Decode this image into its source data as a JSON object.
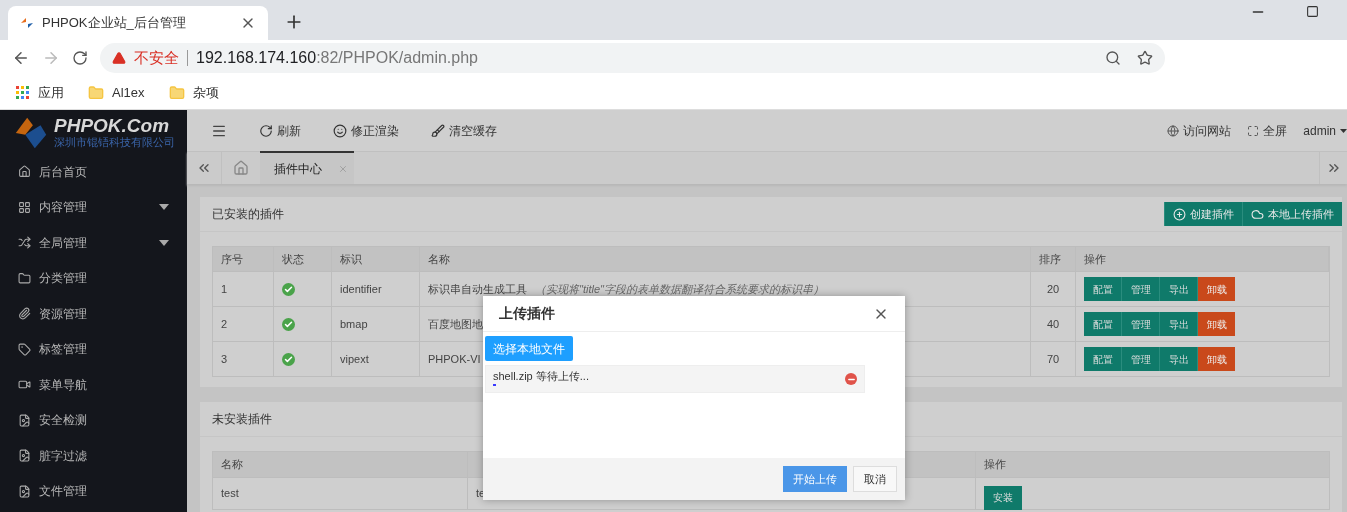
{
  "browser": {
    "tab_title": "PHPOK企业站_后台管理",
    "security_label": "不安全",
    "url_host": "192.168.174.160",
    "url_rest": ":82/PHPOK/admin.php",
    "bookmarks": [
      {
        "label": "应用",
        "kind": "apps"
      },
      {
        "label": "Al1ex",
        "kind": "folder"
      },
      {
        "label": "杂项",
        "kind": "folder"
      }
    ]
  },
  "logo": {
    "title": "PHPOK.Com",
    "subtitle": "深圳市锟铻科技有限公司"
  },
  "sidebar": {
    "items": [
      {
        "label": "后台首页",
        "expandable": false
      },
      {
        "label": "内容管理",
        "expandable": true
      },
      {
        "label": "全局管理",
        "expandable": true
      },
      {
        "label": "分类管理",
        "expandable": false
      },
      {
        "label": "资源管理",
        "expandable": false
      },
      {
        "label": "标签管理",
        "expandable": false
      },
      {
        "label": "菜单导航",
        "expandable": false
      },
      {
        "label": "安全检测",
        "expandable": false
      },
      {
        "label": "脏字过滤",
        "expandable": false
      },
      {
        "label": "文件管理",
        "expandable": false
      }
    ]
  },
  "toolbar": {
    "items": [
      {
        "label": "刷新"
      },
      {
        "label": "修正渲染"
      },
      {
        "label": "清空缓存"
      }
    ],
    "right": [
      {
        "label": "访问网站"
      },
      {
        "label": "全屏"
      }
    ],
    "user": "admin"
  },
  "tabs": [
    {
      "label": "插件中心",
      "selected": true
    }
  ],
  "installed": {
    "title": "已安装的插件",
    "actions": [
      {
        "label": "创建插件"
      },
      {
        "label": "本地上传插件"
      }
    ],
    "columns": [
      "序号",
      "状态",
      "标识",
      "名称",
      "排序",
      "操作"
    ],
    "rows": [
      {
        "index": "1",
        "enabled": true,
        "identifier": "identifier",
        "name": "标识串自动生成工具",
        "note": "（实现将\"title\"字段的表单数据翻译符合系统要求的标识串）",
        "sort": "20",
        "buttons": [
          {
            "label": "配置",
            "kind": "primary"
          },
          {
            "label": "管理",
            "kind": "primary"
          },
          {
            "label": "导出",
            "kind": "primary"
          },
          {
            "label": "卸载",
            "kind": "danger"
          }
        ]
      },
      {
        "index": "2",
        "enabled": true,
        "identifier": "bmap",
        "name": "百度地图地",
        "sort": "40",
        "buttons": [
          {
            "label": "配置",
            "kind": "primary"
          },
          {
            "label": "管理",
            "kind": "primary"
          },
          {
            "label": "导出",
            "kind": "primary"
          },
          {
            "label": "卸载",
            "kind": "danger"
          }
        ]
      },
      {
        "index": "3",
        "enabled": true,
        "identifier": "vipext",
        "name": "PHPOK-VI",
        "sort": "70",
        "buttons": [
          {
            "label": "配置",
            "kind": "primary"
          },
          {
            "label": "管理",
            "kind": "primary"
          },
          {
            "label": "导出",
            "kind": "primary"
          },
          {
            "label": "卸载",
            "kind": "danger"
          }
        ]
      }
    ]
  },
  "uninstalled": {
    "title": "未安装插件",
    "columns": [
      "名称",
      "操作"
    ],
    "rows": [
      {
        "name": "test",
        "column_2": "te",
        "button": "安装"
      }
    ]
  },
  "dialog": {
    "title": "上传插件",
    "pick_button": "选择本地文件",
    "files": [
      {
        "name": "shell.zip",
        "status": "等待上传...",
        "level": 0.01
      }
    ],
    "buttons": [
      {
        "label": "开始上传",
        "kind": "primary"
      },
      {
        "label": "取消",
        "kind": "default"
      }
    ]
  }
}
